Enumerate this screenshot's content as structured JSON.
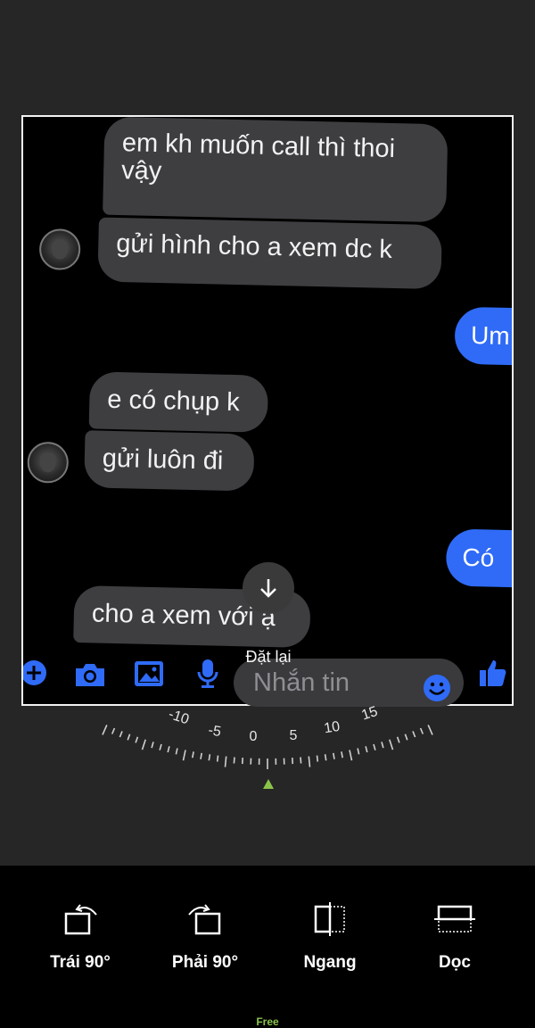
{
  "messages": [
    {
      "side": "received",
      "text_lines": [
        "em kh muốn call thì thoi",
        "vậy"
      ]
    },
    {
      "side": "received",
      "text": "gửi hình cho a xem dc k",
      "avatar": true
    },
    {
      "side": "sent",
      "text": "Um"
    },
    {
      "side": "received",
      "text": "e có chụp k"
    },
    {
      "side": "received",
      "text": "gửi luôn đi",
      "avatar": true
    },
    {
      "side": "sent",
      "text": "Có"
    },
    {
      "side": "received",
      "text": "cho a xem với ạ"
    }
  ],
  "messenger_toolbar": {
    "icons": [
      "plus-icon",
      "camera-icon",
      "image-icon",
      "microphone-icon",
      "emoji-icon",
      "thumbs-up-icon"
    ],
    "input_placeholder": "Nhắn tin",
    "accent_color": "#2f6bf6"
  },
  "editor": {
    "reset_label": "Đặt lại",
    "rotation_dial": {
      "ticks": [
        "-10",
        "-5",
        "0",
        "5",
        "10",
        "15"
      ],
      "value": 0,
      "pointer_color": "#8bc34a"
    }
  },
  "tools": [
    {
      "label": "Trái 90°",
      "icon": "rotate-left-icon"
    },
    {
      "label": "Phải 90°",
      "icon": "rotate-right-icon"
    },
    {
      "label": "Ngang",
      "icon": "flip-horizontal-icon"
    },
    {
      "label": "Dọc",
      "icon": "flip-vertical-icon"
    }
  ],
  "footer_label": "Free"
}
